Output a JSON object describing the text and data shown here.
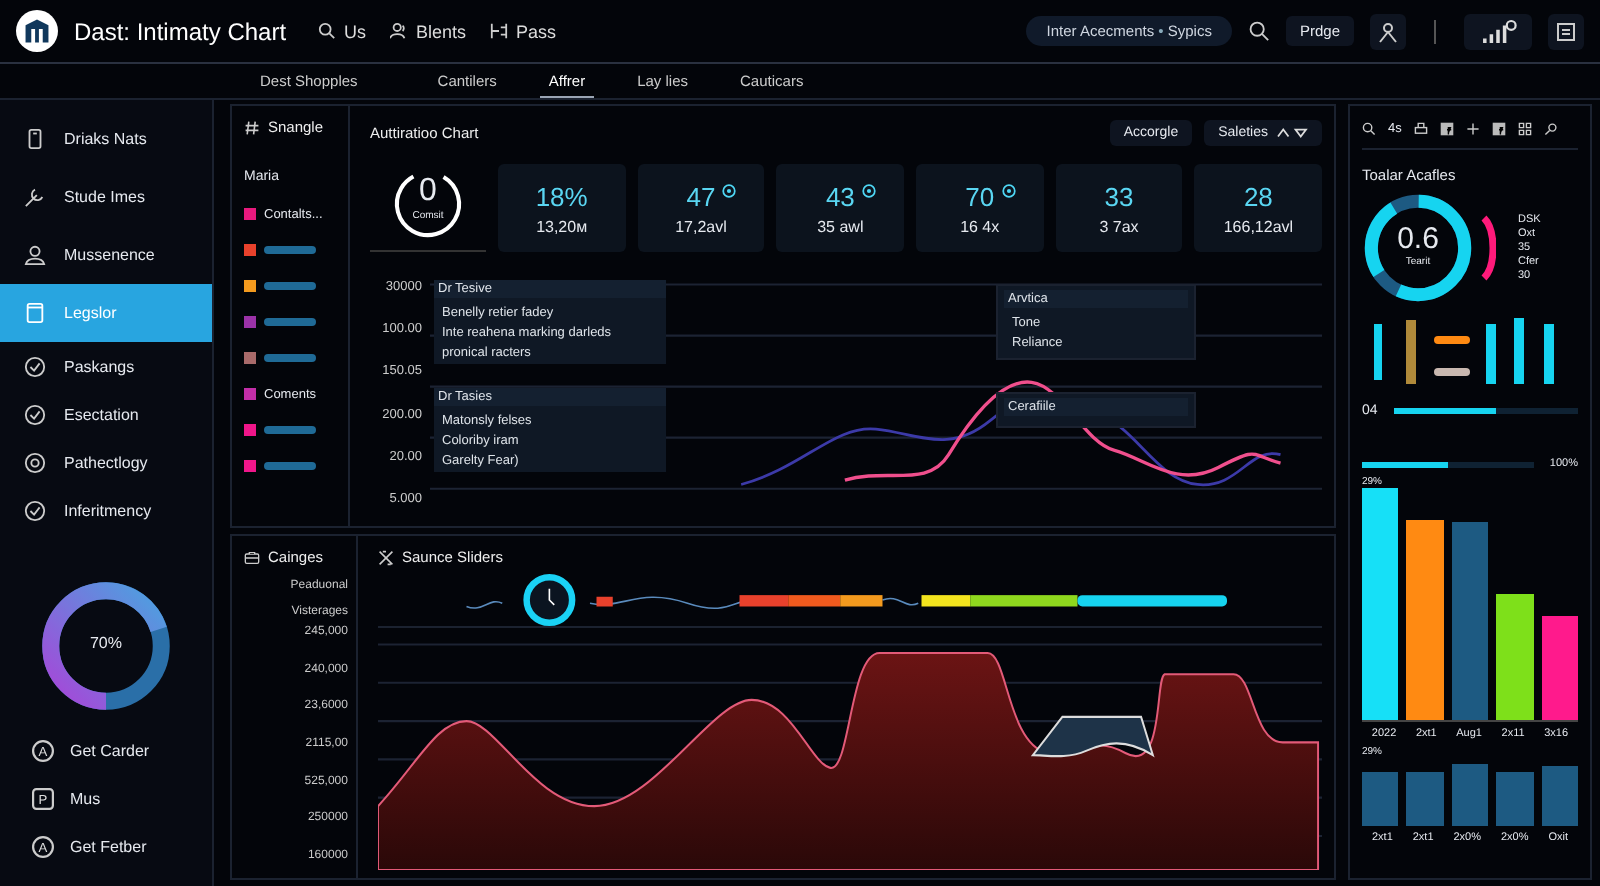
{
  "header": {
    "title": "Dast: Intimaty Chart",
    "nav": [
      {
        "label": "Us"
      },
      {
        "label": "Blents"
      },
      {
        "label": "Pass"
      }
    ],
    "pill": [
      "Inter Acecments",
      "•",
      "Sypics"
    ],
    "button": "Prdge"
  },
  "subtabs": {
    "lead": "Dest Shopples",
    "tabs": [
      {
        "label": "Cantilers",
        "selected": false
      },
      {
        "label": "Affrer",
        "selected": true
      },
      {
        "label": "Lay lies",
        "selected": false
      },
      {
        "label": "Cauticars",
        "selected": false
      }
    ]
  },
  "sidebar": {
    "items": [
      {
        "label": "Driaks Nats",
        "selected": false
      },
      {
        "label": "Stude Imes",
        "selected": false
      },
      {
        "label": "Mussenence",
        "selected": false
      },
      {
        "label": "Legslor",
        "selected": true
      },
      {
        "label": "Paskangs",
        "selected": false
      },
      {
        "label": "Esectation",
        "selected": false
      },
      {
        "label": "Pathectlogy",
        "selected": false
      },
      {
        "label": "Inferitmency",
        "selected": false
      }
    ],
    "donut": {
      "label": "70%"
    },
    "links": [
      {
        "label": "Get Carder",
        "icon": "A"
      },
      {
        "label": "Mus",
        "icon": "P"
      },
      {
        "label": "Get Fetber",
        "icon": "A"
      }
    ]
  },
  "legend": {
    "title": "Snangle",
    "subtitle": "Maria",
    "items": [
      {
        "kind": "label",
        "label": "Contalts...",
        "color": "#e8197d"
      },
      {
        "kind": "bar",
        "color": "#e8412c"
      },
      {
        "kind": "bar",
        "color": "#f39a1e"
      },
      {
        "kind": "bar",
        "color": "#9b32a8"
      },
      {
        "kind": "bar",
        "color": "#a86a6a"
      },
      {
        "kind": "label",
        "label": "Coments",
        "color": "#c32ea8"
      },
      {
        "kind": "bar",
        "color": "#f0168a"
      },
      {
        "kind": "bar",
        "color": "#f0168a"
      }
    ]
  },
  "chart_panel": {
    "title": "Auttiratioo Chart",
    "buttons": [
      "Accorgle",
      "Saleties"
    ],
    "gauge": {
      "value": "0",
      "label": "Comsit"
    },
    "kpis": [
      {
        "value": "18%",
        "sub": "13,20м",
        "badge": false
      },
      {
        "value": "47",
        "sub": "17,2avl",
        "badge": true
      },
      {
        "value": "43",
        "sub": "35 awl",
        "badge": true
      },
      {
        "value": "70",
        "sub": "16 4x",
        "badge": true
      },
      {
        "value": "33",
        "sub": "3 7ax",
        "badge": false
      },
      {
        "value": "28",
        "sub": "166,12avl",
        "badge": false
      }
    ],
    "y_labels": [
      "30000",
      "100.00",
      "150.05",
      "200.00",
      "20.00",
      "5.000"
    ],
    "boxes": [
      {
        "title": "Dr Tesive",
        "lines": [
          "Benelly retier fadey",
          "Inte reahena marking darleds",
          "pronical racters"
        ]
      },
      {
        "title": "Dr Tasies",
        "lines": [
          "Matonsly felses",
          "Coloriby iram",
          "Garelty Fear)"
        ]
      },
      {
        "title": "Arvtica",
        "lines": [
          "Tone",
          "Reliance"
        ]
      },
      {
        "title": "Cerafiile"
      }
    ]
  },
  "bottom": {
    "title": "Cainges",
    "labels": [
      "Peaduonal",
      "Visterages"
    ],
    "y_labels": [
      "245,000",
      "240,000",
      "23,6000",
      "2115,00",
      "525,000",
      "250000",
      "160000"
    ],
    "chart_title": "Saunce Sliders"
  },
  "right_panel": {
    "count": "4s",
    "title": "Toalar Acafles",
    "gauge_value": "0.6",
    "gauge_label": "Tearit",
    "legend": [
      "DSK",
      "Oxt",
      "35",
      "Cfer",
      "30"
    ],
    "progress": [
      {
        "label": "04",
        "level": 0.55
      },
      {
        "label": "100%",
        "level": 0.5
      }
    ],
    "bars_top_label": "29%",
    "bars_labels": [
      "2022",
      "2xt1",
      "Aug1",
      "2x11",
      "3x16"
    ],
    "bars2_top_label": "29%",
    "bars2_labels": [
      "2xt1",
      "2xt1",
      "2x0%",
      "2x0%",
      "Oxit"
    ]
  }
}
